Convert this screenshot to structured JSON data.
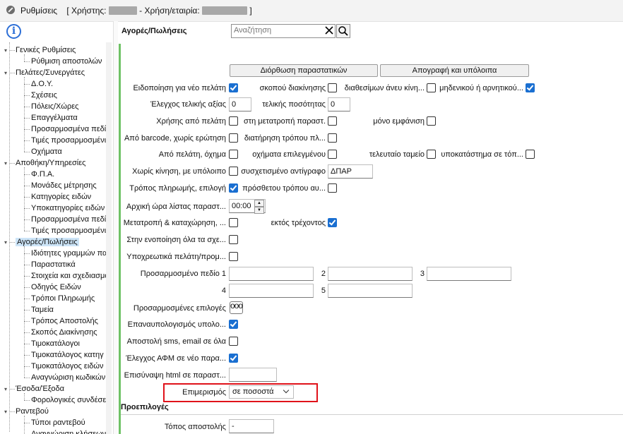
{
  "window": {
    "title_prefix": "Ρυθμίσεις",
    "user_label": "[ Χρήστης:",
    "year_label": "- Χρήση/εταιρία:",
    "close_bracket": "]"
  },
  "sidebar": {
    "items": [
      {
        "label": "Γενικές Ρυθμίσεις",
        "level": 0,
        "expanded": true
      },
      {
        "label": "Ρύθμιση αποστολών",
        "level": 1
      },
      {
        "label": "Πελάτες/Συνεργάτες",
        "level": 0,
        "expanded": true
      },
      {
        "label": "Δ.Ο.Υ.",
        "level": 1
      },
      {
        "label": "Σχέσεις",
        "level": 1
      },
      {
        "label": "Πόλεις/Χώρες",
        "level": 1
      },
      {
        "label": "Επαγγέλματα",
        "level": 1
      },
      {
        "label": "Προσαρμοσμένα πεδί",
        "level": 1
      },
      {
        "label": "Τιμές προσαρμοσμένι",
        "level": 1
      },
      {
        "label": "Οχήματα",
        "level": 1
      },
      {
        "label": "Αποθήκη/Υπηρεσίες",
        "level": 0,
        "expanded": true
      },
      {
        "label": "Φ.Π.Α.",
        "level": 1
      },
      {
        "label": "Μονάδες μέτρησης",
        "level": 1
      },
      {
        "label": "Κατηγορίες ειδών",
        "level": 1
      },
      {
        "label": "Υποκατηγορίες ειδών",
        "level": 1
      },
      {
        "label": "Προσαρμοσμένα πεδί",
        "level": 1
      },
      {
        "label": "Τιμές προσαρμοσμένι",
        "level": 1
      },
      {
        "label": "Αγορές/Πωλήσεις",
        "level": 0,
        "expanded": true,
        "selected": true
      },
      {
        "label": "Ιδιότητες γραμμών παι",
        "level": 1
      },
      {
        "label": "Παραστατικά",
        "level": 1
      },
      {
        "label": "Στοιχεία και σχεδιασμό",
        "level": 1
      },
      {
        "label": "Οδηγός Ειδών",
        "level": 1
      },
      {
        "label": "Τρόποι Πληρωμής",
        "level": 1
      },
      {
        "label": "Ταμεία",
        "level": 1
      },
      {
        "label": "Τρόπος Αποστολής",
        "level": 1
      },
      {
        "label": "Σκοπός Διακίνησης",
        "level": 1
      },
      {
        "label": "Τιμοκατάλογοι",
        "level": 1
      },
      {
        "label": "Τιμοκατάλογος κατηγ",
        "level": 1
      },
      {
        "label": "Τιμοκατάλογος ειδών",
        "level": 1
      },
      {
        "label": "Αναγνώριση κωδικών",
        "level": 1
      },
      {
        "label": "Έσοδα/Έξοδα",
        "level": 0,
        "expanded": true
      },
      {
        "label": "Φορολογικές συνδέσε",
        "level": 1
      },
      {
        "label": "Ραντεβού",
        "level": 0,
        "expanded": true
      },
      {
        "label": "Τύποι ραντεβού",
        "level": 1
      },
      {
        "label": "Αναγνώριση κλήσεων",
        "level": 1
      }
    ]
  },
  "header": {
    "section_title": "Αγορές/Πωλήσεις",
    "search_placeholder": "Αναζήτηση"
  },
  "buttons": {
    "fix_docs": "Διόρθωση παραστατικών",
    "inventory": "Απογραφή και υπόλοιπα"
  },
  "form": {
    "new_customer_notify": "Ειδοποίηση για νέο πελάτη",
    "purpose_shipping": "σκοπού διακίνησης",
    "available_without_move": "διαθεσίμων άνευ κίνη...",
    "zero_or_negative": "μηδενικού ή αρνητικού...",
    "check_final_value": "Έλεγχος τελικής αξίας",
    "final_value_input": "0",
    "final_quantity": "τελικής ποσότητας",
    "final_quantity_input": "0",
    "price_from_customer": "Χρήσης από πελάτη",
    "on_convert_doc": "στη μετατροπή παραστ.",
    "display_only": "μόνο εμφάνιση",
    "from_barcode": "Από barcode, χωρίς ερώτηση",
    "keep_method": "διατήρηση τρόπου πλ...",
    "from_customer_vehicle": "Από πελάτη, όχημα",
    "selected_vehicle": "οχήματα επιλεγμένου",
    "last_cashbox": "τελευταίο ταμείο",
    "branch_in": "υποκατάστημα σε τόπ...",
    "no_movement_balance": "Χωρίς κίνηση, με υπόλοιπο",
    "related_copy": "συσχετισμένο αντίγραφο",
    "related_copy_input": "ΔΠΑΡ",
    "payment_method_choice": "Τρόπος πληρωμής, επιλογή",
    "additional_payment": "πρόσθετου τρόπου αυ...",
    "initial_list_time": "Αρχική ώρα λίστας παραστ...",
    "initial_list_time_input": "00:00",
    "convert_and_register": "Μετατροπή & καταχώρηση, ...",
    "except_current": "εκτός τρέχοντος",
    "on_merge_all": "Στην ενοποίηση όλα τα σχε...",
    "required_customer": "Υποχρεωτικά πελάτη/προμ...",
    "custom_field_1": "Προσαρμοσμένο πεδίο 1",
    "num_2": "2",
    "num_3": "3",
    "num_4": "4",
    "num_5": "5",
    "custom_options": "Προσαρμοσμένες επιλογές",
    "custom_options_btn": "ooo",
    "recalculate_balance": "Επαναυπολογισμός υπολο...",
    "send_sms_email": "Αποστολή sms, email σε όλα",
    "check_vat_new": "Έλεγχος ΑΦΜ σε νέο παρα...",
    "attach_html": "Επισύναψη html σε παραστ...",
    "allocation": "Επιμερισμός",
    "allocation_value": "σε ποσοστά"
  },
  "defaults": {
    "section_title": "Προεπιλογές",
    "shipping_place": "Τόπος αποστολής",
    "shipping_place_input": "-"
  },
  "colors": {
    "accent": "#1a6fd1",
    "green_bar": "#6fc266",
    "highlight": "#e0121a",
    "selected_item": "#cce4f7"
  }
}
